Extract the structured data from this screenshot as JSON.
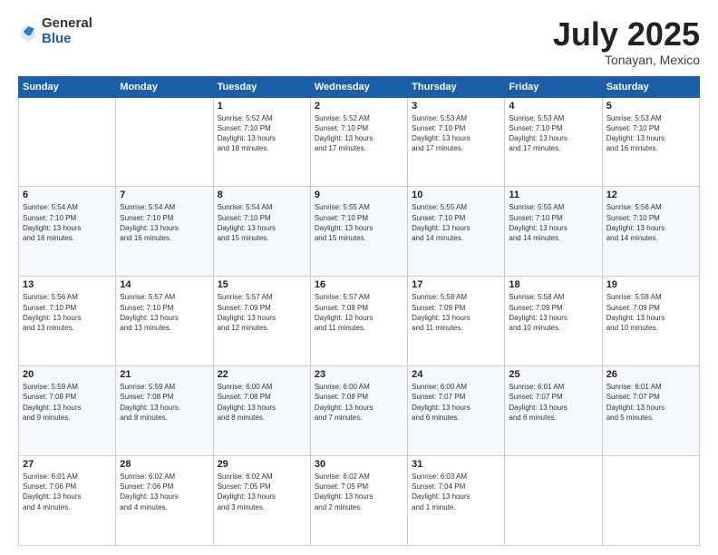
{
  "header": {
    "logo": {
      "general": "General",
      "blue": "Blue"
    },
    "title": "July 2025",
    "location": "Tonayan, Mexico"
  },
  "days_of_week": [
    "Sunday",
    "Monday",
    "Tuesday",
    "Wednesday",
    "Thursday",
    "Friday",
    "Saturday"
  ],
  "weeks": [
    [
      {
        "day": "",
        "info": ""
      },
      {
        "day": "",
        "info": ""
      },
      {
        "day": "1",
        "info": "Sunrise: 5:52 AM\nSunset: 7:10 PM\nDaylight: 13 hours\nand 18 minutes."
      },
      {
        "day": "2",
        "info": "Sunrise: 5:52 AM\nSunset: 7:10 PM\nDaylight: 13 hours\nand 17 minutes."
      },
      {
        "day": "3",
        "info": "Sunrise: 5:53 AM\nSunset: 7:10 PM\nDaylight: 13 hours\nand 17 minutes."
      },
      {
        "day": "4",
        "info": "Sunrise: 5:53 AM\nSunset: 7:10 PM\nDaylight: 13 hours\nand 17 minutes."
      },
      {
        "day": "5",
        "info": "Sunrise: 5:53 AM\nSunset: 7:10 PM\nDaylight: 13 hours\nand 16 minutes."
      }
    ],
    [
      {
        "day": "6",
        "info": "Sunrise: 5:54 AM\nSunset: 7:10 PM\nDaylight: 13 hours\nand 16 minutes."
      },
      {
        "day": "7",
        "info": "Sunrise: 5:54 AM\nSunset: 7:10 PM\nDaylight: 13 hours\nand 16 minutes."
      },
      {
        "day": "8",
        "info": "Sunrise: 5:54 AM\nSunset: 7:10 PM\nDaylight: 13 hours\nand 15 minutes."
      },
      {
        "day": "9",
        "info": "Sunrise: 5:55 AM\nSunset: 7:10 PM\nDaylight: 13 hours\nand 15 minutes."
      },
      {
        "day": "10",
        "info": "Sunrise: 5:55 AM\nSunset: 7:10 PM\nDaylight: 13 hours\nand 14 minutes."
      },
      {
        "day": "11",
        "info": "Sunrise: 5:55 AM\nSunset: 7:10 PM\nDaylight: 13 hours\nand 14 minutes."
      },
      {
        "day": "12",
        "info": "Sunrise: 5:56 AM\nSunset: 7:10 PM\nDaylight: 13 hours\nand 14 minutes."
      }
    ],
    [
      {
        "day": "13",
        "info": "Sunrise: 5:56 AM\nSunset: 7:10 PM\nDaylight: 13 hours\nand 13 minutes."
      },
      {
        "day": "14",
        "info": "Sunrise: 5:57 AM\nSunset: 7:10 PM\nDaylight: 13 hours\nand 13 minutes."
      },
      {
        "day": "15",
        "info": "Sunrise: 5:57 AM\nSunset: 7:09 PM\nDaylight: 13 hours\nand 12 minutes."
      },
      {
        "day": "16",
        "info": "Sunrise: 5:57 AM\nSunset: 7:09 PM\nDaylight: 13 hours\nand 11 minutes."
      },
      {
        "day": "17",
        "info": "Sunrise: 5:58 AM\nSunset: 7:09 PM\nDaylight: 13 hours\nand 11 minutes."
      },
      {
        "day": "18",
        "info": "Sunrise: 5:58 AM\nSunset: 7:09 PM\nDaylight: 13 hours\nand 10 minutes."
      },
      {
        "day": "19",
        "info": "Sunrise: 5:58 AM\nSunset: 7:09 PM\nDaylight: 13 hours\nand 10 minutes."
      }
    ],
    [
      {
        "day": "20",
        "info": "Sunrise: 5:59 AM\nSunset: 7:08 PM\nDaylight: 13 hours\nand 9 minutes."
      },
      {
        "day": "21",
        "info": "Sunrise: 5:59 AM\nSunset: 7:08 PM\nDaylight: 13 hours\nand 8 minutes."
      },
      {
        "day": "22",
        "info": "Sunrise: 6:00 AM\nSunset: 7:08 PM\nDaylight: 13 hours\nand 8 minutes."
      },
      {
        "day": "23",
        "info": "Sunrise: 6:00 AM\nSunset: 7:08 PM\nDaylight: 13 hours\nand 7 minutes."
      },
      {
        "day": "24",
        "info": "Sunrise: 6:00 AM\nSunset: 7:07 PM\nDaylight: 13 hours\nand 6 minutes."
      },
      {
        "day": "25",
        "info": "Sunrise: 6:01 AM\nSunset: 7:07 PM\nDaylight: 13 hours\nand 6 minutes."
      },
      {
        "day": "26",
        "info": "Sunrise: 6:01 AM\nSunset: 7:07 PM\nDaylight: 13 hours\nand 5 minutes."
      }
    ],
    [
      {
        "day": "27",
        "info": "Sunrise: 6:01 AM\nSunset: 7:06 PM\nDaylight: 13 hours\nand 4 minutes."
      },
      {
        "day": "28",
        "info": "Sunrise: 6:02 AM\nSunset: 7:06 PM\nDaylight: 13 hours\nand 4 minutes."
      },
      {
        "day": "29",
        "info": "Sunrise: 6:02 AM\nSunset: 7:05 PM\nDaylight: 13 hours\nand 3 minutes."
      },
      {
        "day": "30",
        "info": "Sunrise: 6:02 AM\nSunset: 7:05 PM\nDaylight: 13 hours\nand 2 minutes."
      },
      {
        "day": "31",
        "info": "Sunrise: 6:03 AM\nSunset: 7:04 PM\nDaylight: 13 hours\nand 1 minute."
      },
      {
        "day": "",
        "info": ""
      },
      {
        "day": "",
        "info": ""
      }
    ]
  ]
}
